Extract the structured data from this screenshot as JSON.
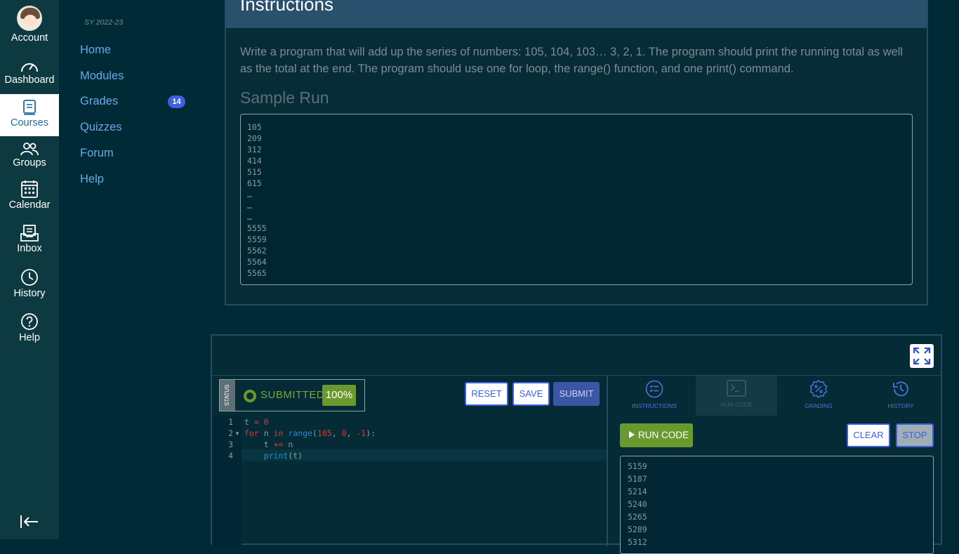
{
  "global_nav": {
    "account": "Account",
    "dashboard": "Dashboard",
    "courses": "Courses",
    "groups": "Groups",
    "calendar": "Calendar",
    "inbox": "Inbox",
    "history": "History",
    "help": "Help"
  },
  "course_nav": {
    "term": "SY 2022-23",
    "links": [
      "Home",
      "Modules",
      "Grades",
      "Quizzes",
      "Forum",
      "Help"
    ],
    "grades_badge": "14"
  },
  "instructions": {
    "title": "Instructions",
    "body": "Write a program that will add up the series of numbers: 105, 104, 103… 3, 2, 1. The program should print the running total as well as the total at the end. The program should use one for loop, the range() function, and one print() command.",
    "sample_title": "Sample Run",
    "sample_lines": [
      "105",
      "209",
      "312",
      "414",
      "515",
      "615",
      "…",
      "…",
      "…",
      "5555",
      "5559",
      "5562",
      "5564",
      "5565"
    ]
  },
  "ide": {
    "status_tag": "STATUS",
    "status_text": "SUBMITTED",
    "score": "100%",
    "reset": "RESET",
    "save": "SAVE",
    "submit": "SUBMIT",
    "line_numbers": [
      "1",
      "2",
      "3",
      "4"
    ],
    "code_lines": [
      "t = 0",
      "for n in range(105, 0, -1):",
      "    t += n",
      "    print(t)"
    ],
    "tabs": [
      "INSTRUCTIONS",
      "RUN CODE",
      "GRADING",
      "HISTORY"
    ],
    "run_code": "RUN CODE",
    "clear": "CLEAR",
    "stop": "STOP",
    "console_lines": [
      "5159",
      "5187",
      "5214",
      "5240",
      "5265",
      "5289",
      "5312"
    ]
  },
  "colors": {
    "background": "#002b36",
    "nav": "#0d3a40",
    "accent_blue": "#3d5fe0",
    "success_green": "#6a9a2d"
  }
}
